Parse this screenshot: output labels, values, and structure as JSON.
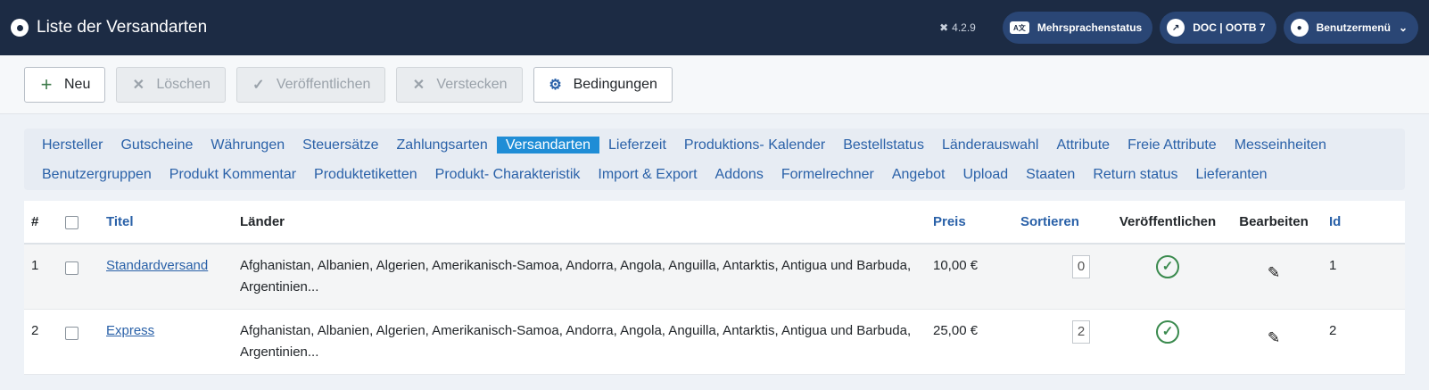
{
  "header": {
    "title": "Liste der Versandarten",
    "version": "4.2.9",
    "pills": [
      {
        "label": "Mehrsprachenstatus",
        "icon": "language-icon"
      },
      {
        "label": "DOC | OOTB 7",
        "icon": "external-link-icon"
      },
      {
        "label": "Benutzermenü",
        "icon": "user-icon"
      }
    ]
  },
  "toolbar": {
    "new_label": "Neu",
    "delete_label": "Löschen",
    "publish_label": "Veröffentlichen",
    "hide_label": "Verstecken",
    "conditions_label": "Bedingungen"
  },
  "subnav": [
    "Hersteller",
    "Gutscheine",
    "Währungen",
    "Steuersätze",
    "Zahlungsarten",
    "Versandarten",
    "Lieferzeit",
    "Produktions- Kalender",
    "Bestellstatus",
    "Länderauswahl",
    "Attribute",
    "Freie Attribute",
    "Messeinheiten",
    "Benutzergruppen",
    "Produkt Kommentar",
    "Produktetiketten",
    "Produkt- Charakteristik",
    "Import & Export",
    "Addons",
    "Formelrechner",
    "Angebot",
    "Upload",
    "Staaten",
    "Return status",
    "Lieferanten"
  ],
  "subnav_active": "Versandarten",
  "table": {
    "headers": {
      "num": "#",
      "title": "Titel",
      "countries": "Länder",
      "price": "Preis",
      "sort": "Sortieren",
      "publish": "Veröffentlichen",
      "edit": "Bearbeiten",
      "id": "Id"
    },
    "rows": [
      {
        "num": "1",
        "title": "Standardversand",
        "countries": "Afghanistan, Albanien, Algerien, Amerikanisch-Samoa, Andorra, Angola, Anguilla, Antarktis, Antigua und Barbuda, Argentinien...",
        "price": "10,00 €",
        "order": "0",
        "id": "1"
      },
      {
        "num": "2",
        "title": "Express",
        "countries": "Afghanistan, Albanien, Algerien, Amerikanisch-Samoa, Andorra, Angola, Anguilla, Antarktis, Antigua und Barbuda, Argentinien...",
        "price": "25,00 €",
        "order": "2",
        "id": "2"
      }
    ]
  }
}
